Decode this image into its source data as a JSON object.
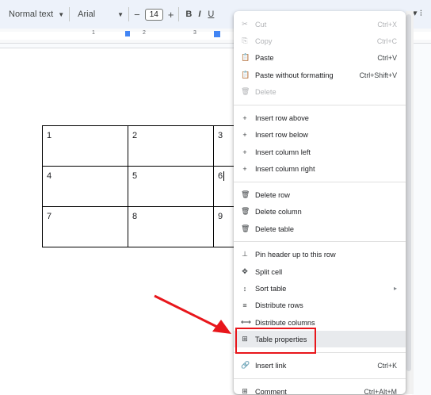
{
  "toolbar": {
    "style": "Normal text",
    "font": "Arial",
    "minus": "−",
    "size": "14",
    "plus": "+",
    "bold": "B",
    "italic": "I",
    "underline": "U"
  },
  "ruler": {
    "nums": [
      "1",
      "2",
      "3"
    ]
  },
  "table": {
    "rows": [
      [
        "1",
        "2",
        "3"
      ],
      [
        "4",
        "5",
        "6"
      ],
      [
        "7",
        "8",
        "9"
      ]
    ]
  },
  "menu": {
    "items": [
      {
        "icon": "✂",
        "label": "Cut",
        "shortcut": "Ctrl+X",
        "disabled": true
      },
      {
        "icon": "⎘",
        "label": "Copy",
        "shortcut": "Ctrl+C",
        "disabled": true
      },
      {
        "icon": "📋",
        "label": "Paste",
        "shortcut": "Ctrl+V",
        "disabled": false
      },
      {
        "icon": "📋",
        "label": "Paste without formatting",
        "shortcut": "Ctrl+Shift+V",
        "disabled": false
      },
      {
        "icon": "🗑",
        "label": "Delete",
        "shortcut": "",
        "disabled": true
      },
      {
        "icon": "+",
        "label": "Insert row above",
        "shortcut": "",
        "disabled": false
      },
      {
        "icon": "+",
        "label": "Insert row below",
        "shortcut": "",
        "disabled": false
      },
      {
        "icon": "+",
        "label": "Insert column left",
        "shortcut": "",
        "disabled": false
      },
      {
        "icon": "+",
        "label": "Insert column right",
        "shortcut": "",
        "disabled": false
      },
      {
        "icon": "🗑",
        "label": "Delete row",
        "shortcut": "",
        "disabled": false
      },
      {
        "icon": "🗑",
        "label": "Delete column",
        "shortcut": "",
        "disabled": false
      },
      {
        "icon": "🗑",
        "label": "Delete table",
        "shortcut": "",
        "disabled": false
      },
      {
        "icon": "⊥",
        "label": "Pin header up to this row",
        "shortcut": "",
        "disabled": false
      },
      {
        "icon": "✥",
        "label": "Split cell",
        "shortcut": "",
        "disabled": false
      },
      {
        "icon": "↕",
        "label": "Sort table",
        "shortcut": "▸",
        "disabled": false
      },
      {
        "icon": "≡",
        "label": "Distribute rows",
        "shortcut": "",
        "disabled": false
      },
      {
        "icon": "⟷",
        "label": "Distribute columns",
        "shortcut": "",
        "disabled": false
      },
      {
        "icon": "⊞",
        "label": "Table properties",
        "shortcut": "",
        "disabled": false
      },
      {
        "icon": "🔗",
        "label": "Insert link",
        "shortcut": "Ctrl+K",
        "disabled": false
      },
      {
        "icon": "⊞",
        "label": "Comment",
        "shortcut": "Ctrl+Alt+M",
        "disabled": false
      }
    ]
  },
  "colors": {
    "highlight": "#e8161b",
    "hover": "#e8eaed"
  }
}
